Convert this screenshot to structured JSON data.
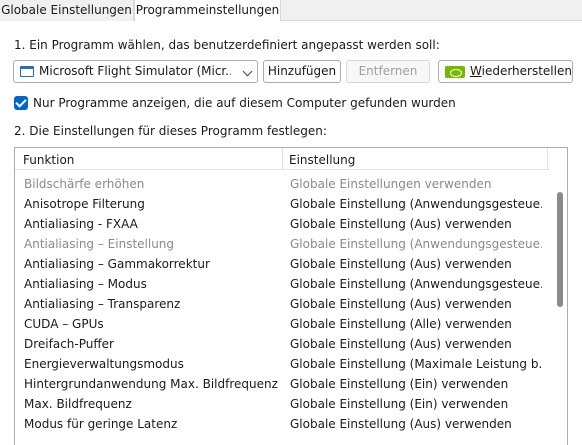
{
  "tabs": [
    {
      "label": "Globale Einstellungen"
    },
    {
      "label": "Programmeinstellungen"
    }
  ],
  "step1": {
    "label": "1. Ein Programm wählen, das benutzerdefiniert angepasst werden soll:"
  },
  "program_select": {
    "value": "Microsoft Flight Simulator (Micr..."
  },
  "buttons": {
    "add": "Hinzufügen",
    "remove": "Entfernen",
    "restore_underlined": "W",
    "restore_rest": "iederherstellen"
  },
  "filter_checkbox": {
    "checked": true,
    "label": "Nur Programme anzeigen, die auf diesem Computer gefunden wurden"
  },
  "step2": {
    "label": "2. Die Einstellungen für dieses Programm festlegen:"
  },
  "grid": {
    "headers": {
      "feature": "Funktion",
      "setting": "Einstellung"
    },
    "rows": [
      {
        "feature": "Bildschärfe erhöhen",
        "setting": "Globale Einstellungen verwenden",
        "dim": true
      },
      {
        "feature": "Anisotrope Filterung",
        "setting": "Globale Einstellung (Anwendungsgesteue...",
        "dim": false
      },
      {
        "feature": "Antialiasing - FXAA",
        "setting": "Globale Einstellung (Aus) verwenden",
        "dim": false
      },
      {
        "feature": "Antialiasing – Einstellung",
        "setting": "Globale Einstellung (Anwendungsgesteue...",
        "dim": true
      },
      {
        "feature": "Antialiasing – Gammakorrektur",
        "setting": "Globale Einstellung (Aus) verwenden",
        "dim": false
      },
      {
        "feature": "Antialiasing – Modus",
        "setting": "Globale Einstellung (Anwendungsgesteue...",
        "dim": false
      },
      {
        "feature": "Antialiasing – Transparenz",
        "setting": "Globale Einstellung (Aus) verwenden",
        "dim": false
      },
      {
        "feature": "CUDA – GPUs",
        "setting": "Globale Einstellung (Alle) verwenden",
        "dim": false
      },
      {
        "feature": "Dreifach-Puffer",
        "setting": "Globale Einstellung (Aus) verwenden",
        "dim": false
      },
      {
        "feature": "Energieverwaltungsmodus",
        "setting": "Globale Einstellung (Maximale Leistung b...",
        "dim": false
      },
      {
        "feature": "Hintergrundanwendung Max. Bildfrequenz",
        "setting": "Globale Einstellung (Ein) verwenden",
        "dim": false
      },
      {
        "feature": "Max. Bildfrequenz",
        "setting": "Globale Einstellung (Ein) verwenden",
        "dim": false
      },
      {
        "feature": "Modus für geringe Latenz",
        "setting": "Globale Einstellung (Aus) verwenden",
        "dim": false
      }
    ]
  },
  "icons": {
    "program": "application-window-icon",
    "dropdown": "chevron-down-icon",
    "nvidia": "nvidia-logo-icon",
    "check": "checkmark-icon"
  },
  "colors": {
    "accent": "#0066cc",
    "nvidia_green": "#76b900",
    "disabled_text": "#8a8a8a"
  }
}
